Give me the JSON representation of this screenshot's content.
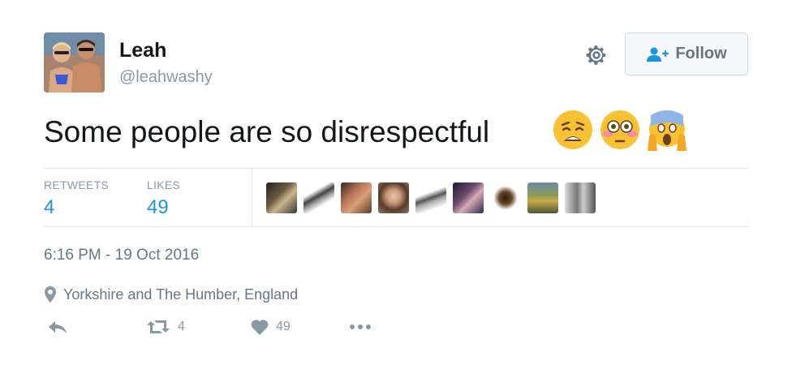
{
  "user": {
    "name": "Leah",
    "handle": "@leahwashy",
    "avatar_icon": "profile-photo"
  },
  "header": {
    "settings_icon": "gear-icon",
    "follow_label": "Follow"
  },
  "tweet": {
    "text": "Some people are so disrespectful",
    "emojis": [
      "weary-face",
      "flushed-face",
      "face-screaming-in-fear"
    ]
  },
  "stats": {
    "retweets_label": "RETWEETS",
    "retweets_count": "4",
    "likes_label": "LIKES",
    "likes_count": "49",
    "liker_avatars": 9
  },
  "meta": {
    "timestamp": "6:16 PM - 19 Oct 2016",
    "location": "Yorkshire and The Humber, England"
  },
  "actions": {
    "retweet_count": "4",
    "like_count": "49"
  },
  "colors": {
    "link_blue": "#1b95e0",
    "muted": "#8899a6",
    "border": "#e1e8ed"
  }
}
